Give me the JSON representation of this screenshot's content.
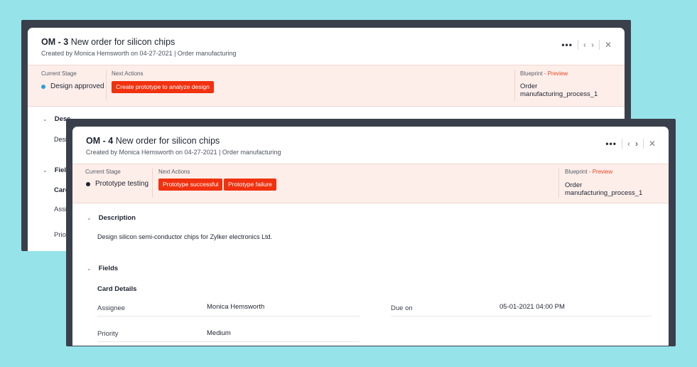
{
  "back_card": {
    "id": "OM - 3",
    "title": "New order for silicon chips",
    "created": "Created by Monica Hemsworth on 04-27-2021 | Order manufacturing",
    "current_stage_label": "Current Stage",
    "current_stage": "Design approved",
    "next_actions_label": "Next Actions",
    "next_action": "Create prototype to analyze design",
    "blueprint_label": "Blueprint",
    "preview_label": "- Preview",
    "blueprint_line1": "Order",
    "blueprint_line2": "manufacturing_process_1",
    "description_heading": "Desc",
    "description_peek": "Desi",
    "fields_heading": "Field",
    "card_peek": "Card",
    "assignee_peek": "Assi",
    "priority_peek": "Priori",
    "stage_dot_color": "#2a9fd8"
  },
  "front_card": {
    "id": "OM - 4",
    "title": "New order for silicon chips",
    "created": "Created by Monica Hemsworth on 04-27-2021 | Order manufacturing",
    "current_stage_label": "Current Stage",
    "current_stage": "Prototype testing",
    "next_actions_label": "Next Actions",
    "action_success": "Prototype successful",
    "action_failure": "Prototype failure",
    "blueprint_label": "Blueprint",
    "preview_label": "- Preview",
    "blueprint_line1": "Order",
    "blueprint_line2": "manufacturing_process_1",
    "description_heading": "Description",
    "description_text": "Design silicon semi-conductor chips for Zylker electronics Ltd.",
    "fields_heading": "Fields",
    "card_details": "Card Details",
    "assignee_label": "Assignee",
    "assignee_value": "Monica Hemsworth",
    "due_label": "Due on",
    "due_value": "05-01-2021 04:00 PM",
    "priority_label": "Priority",
    "priority_value": "Medium",
    "stage_dot_color": "#1f2430"
  },
  "header_icons": [
    "more-icon",
    "chevron-left-icon",
    "chevron-right-icon",
    "close-icon"
  ],
  "colors": {
    "background": "#96e3ea",
    "accent_red": "#f1310f",
    "stage_band": "#fdeeea",
    "frame": "#3a404b"
  }
}
